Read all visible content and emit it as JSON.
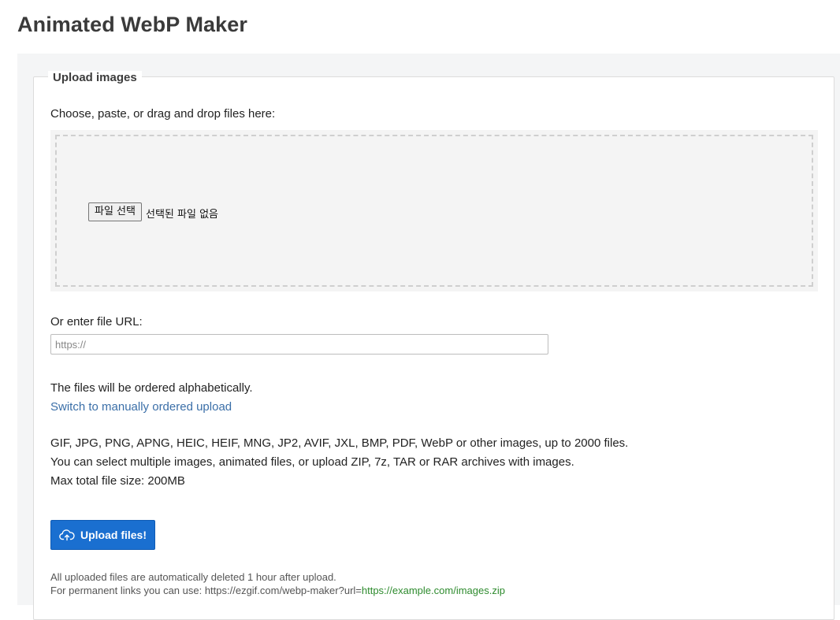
{
  "page": {
    "title": "Animated WebP Maker"
  },
  "upload": {
    "legend": "Upload images",
    "choose_label": "Choose, paste, or drag and drop files here:",
    "file_button_label": "파일 선택",
    "file_status": "선택된 파일 없음",
    "url_label": "Or enter file URL:",
    "url_placeholder": "https://",
    "url_value": "",
    "order_text": "The files will be ordered alphabetically.",
    "switch_link": "Switch to manually ordered upload",
    "formats_text": "GIF, JPG, PNG, APNG, HEIC, HEIF, MNG, JP2, AVIF, JXL, BMP, PDF, WebP or other images, up to 2000 files.",
    "multiple_text": "You can select multiple images, animated files, or upload ZIP, 7z, TAR or RAR archives with images.",
    "max_size_text": "Max total file size: 200MB",
    "upload_button_label": "Upload files!",
    "upload_button_icon": "cloud-upload-icon",
    "note_deleted": "All uploaded files are automatically deleted 1 hour after upload.",
    "note_permanent_prefix": "For permanent links you can use: https://ezgif.com/webp-maker?url=",
    "note_permanent_example": "https://example.com/images.zip"
  },
  "colors": {
    "accent_button": "#1a6fd0",
    "link": "#3b6fa8",
    "example_link": "#2e8b2e",
    "panel_bg": "#f4f5f6"
  }
}
